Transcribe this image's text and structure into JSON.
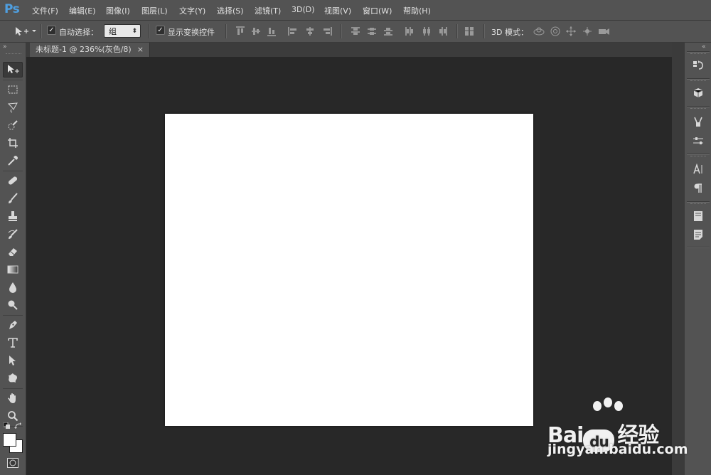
{
  "app": {
    "logo": "Ps"
  },
  "menu": {
    "items": [
      "文件(F)",
      "编辑(E)",
      "图像(I)",
      "图层(L)",
      "文字(Y)",
      "选择(S)",
      "滤镜(T)",
      "3D(D)",
      "视图(V)",
      "窗口(W)",
      "帮助(H)"
    ]
  },
  "options": {
    "auto_select_label": "自动选择：",
    "auto_select_checked": true,
    "auto_select_target": "组",
    "show_transform_label": "显示变换控件",
    "show_transform_checked": true,
    "mode_3d_label": "3D 模式："
  },
  "document": {
    "tab_title": "未标题-1 @ 236%(灰色/8)",
    "tab_close": "×",
    "canvas_color": "#ffffff"
  },
  "tools": [
    "move-tool",
    "marquee-tool",
    "lasso-tool",
    "quick-selection-tool",
    "crop-tool",
    "eyedropper-tool",
    "healing-brush-tool",
    "brush-tool",
    "clone-stamp-tool",
    "history-brush-tool",
    "eraser-tool",
    "gradient-tool",
    "blur-tool",
    "dodge-tool",
    "pen-tool",
    "type-tool",
    "path-selection-tool",
    "shape-tool",
    "hand-tool",
    "zoom-tool"
  ],
  "colors": {
    "foreground": "#ffffff",
    "background": "#ffffff",
    "ui_panel": "#535353",
    "workspace": "#282828",
    "accent": "#4f9fe0"
  },
  "dock": [
    "history-icon",
    "3d-panel-icon",
    "adjustments-icon",
    "properties-icon",
    "character-icon",
    "paragraph-icon",
    "layers-icon",
    "notes-icon"
  ],
  "watermark": {
    "brand_left": "Bai",
    "brand_right": "经验",
    "url": "jingyan.baidu.com"
  }
}
